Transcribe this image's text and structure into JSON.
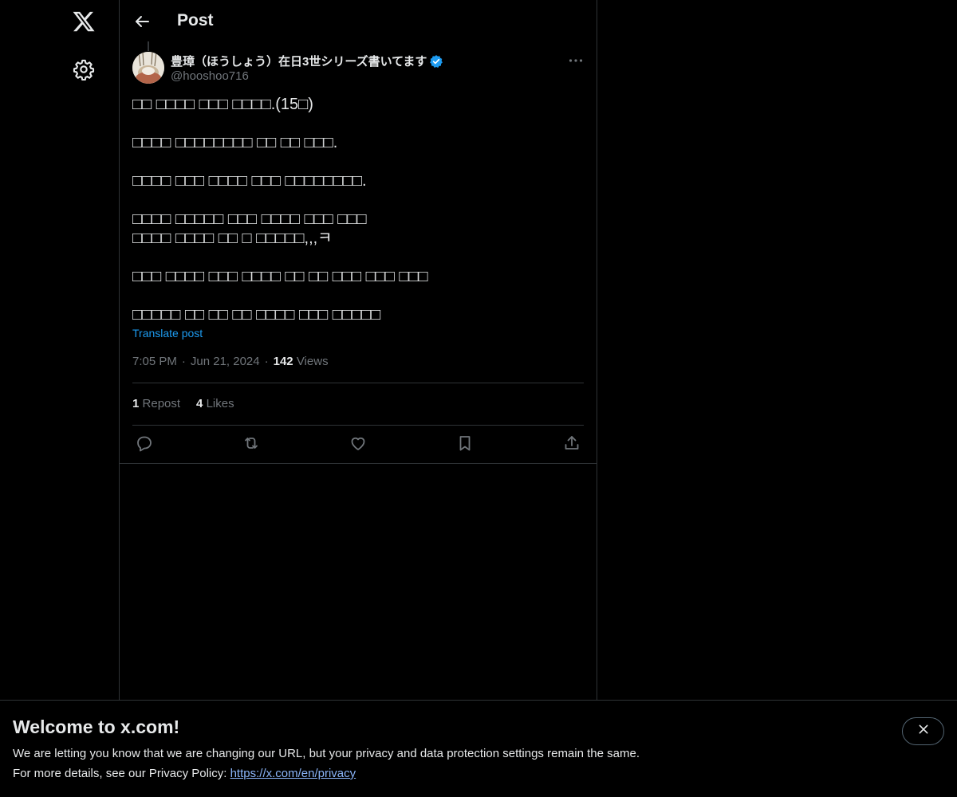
{
  "header": {
    "title": "Post"
  },
  "icons": {
    "logo": "x-logo-icon",
    "settings": "gear-icon",
    "back": "arrow-left-icon",
    "verified": "verified-badge-icon",
    "more": "more-horizontal-icon",
    "reply": "reply-icon",
    "repost": "repost-icon",
    "like": "heart-icon",
    "bookmark": "bookmark-icon",
    "share": "share-icon",
    "close": "close-icon"
  },
  "colors": {
    "accent": "#1d9bf0",
    "background": "#000000",
    "text": "#e7e9ea",
    "muted": "#71767b",
    "border": "#2f3336"
  },
  "post": {
    "author_name": "豊璋（ほうしょう）在日3世シリーズ書いてます",
    "author_handle": "@hooshoo716",
    "paragraphs": [
      "□□ □□□□ □□□ □□□□.(15□)",
      "□□□□ □□□□□□□□ □□ □□ □□□.",
      "□□□□ □□□ □□□□ □□□ □□□□□□□□.",
      "□□□□ □□□□□ □□□ □□□□ □□□ □□□\n□□□□ □□□□ □□ □ □□□□□,,,ㅋ",
      "□□□ □□□□ □□□ □□□□ □□ □□ □□□ □□□ □□□",
      "□□□□□ □□ □□ □□ □□□□ □□□ □□□□□"
    ],
    "translate_label": "Translate post",
    "time": "7:05 PM",
    "date": "Jun 21, 2024",
    "views_count": "142",
    "views_label": "Views",
    "reposts_count": "1",
    "reposts_label": "Repost",
    "likes_count": "4",
    "likes_label": "Likes"
  },
  "banner": {
    "title": "Welcome to x.com!",
    "line1": "We are letting you know that we are changing our URL, but your privacy and data protection settings remain the same.",
    "line2_prefix": "For more details, see our Privacy Policy: ",
    "link_text": "https://x.com/en/privacy"
  }
}
